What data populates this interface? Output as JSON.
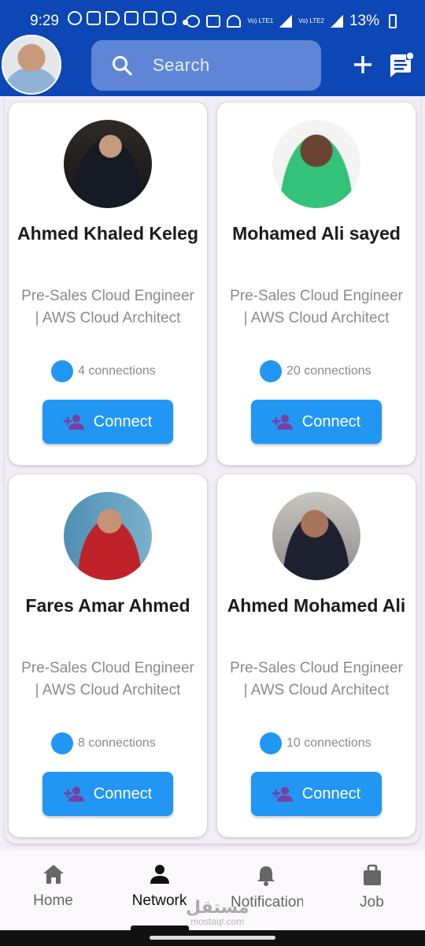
{
  "status_bar": {
    "time": "9:29",
    "battery": "13%",
    "network_labels": [
      "Vo) LTE1",
      "Vo) LTE2"
    ]
  },
  "header": {
    "search": {
      "placeholder": "Search"
    },
    "icons": [
      "profile-avatar",
      "search-icon",
      "plus-icon",
      "message-icon"
    ]
  },
  "suggestions": [
    {
      "name": "Ahmed Khaled Keleg",
      "title": "Pre-Sales Cloud Engineer | AWS Cloud Architect",
      "connections": "4 connections",
      "button": "Connect"
    },
    {
      "name": "Mohamed Ali sayed",
      "title": "Pre-Sales Cloud Engineer | AWS Cloud Architect",
      "connections": "20 connections",
      "button": "Connect"
    },
    {
      "name": "Fares Amar Ahmed",
      "title": "Pre-Sales Cloud Engineer | AWS Cloud Architect",
      "connections": "8 connections",
      "button": "Connect"
    },
    {
      "name": "Ahmed Mohamed Ali",
      "title": "Pre-Sales Cloud Engineer | AWS Cloud Architect",
      "connections": "10 connections",
      "button": "Connect"
    }
  ],
  "bottom_nav": {
    "items": [
      {
        "label": "Home",
        "icon": "home-icon"
      },
      {
        "label": "Network",
        "icon": "person-icon",
        "active": true
      },
      {
        "label": "Notifications",
        "icon": "bell-icon"
      },
      {
        "label": "Job",
        "icon": "briefcase-icon"
      }
    ]
  },
  "watermark": {
    "arabic": "مستقل",
    "latin": "mostaql.com"
  },
  "colors": {
    "app_bar": "#0d47b5",
    "search_bg": "#5f86d6",
    "accent": "#2196f3",
    "background": "#f4eef6"
  }
}
